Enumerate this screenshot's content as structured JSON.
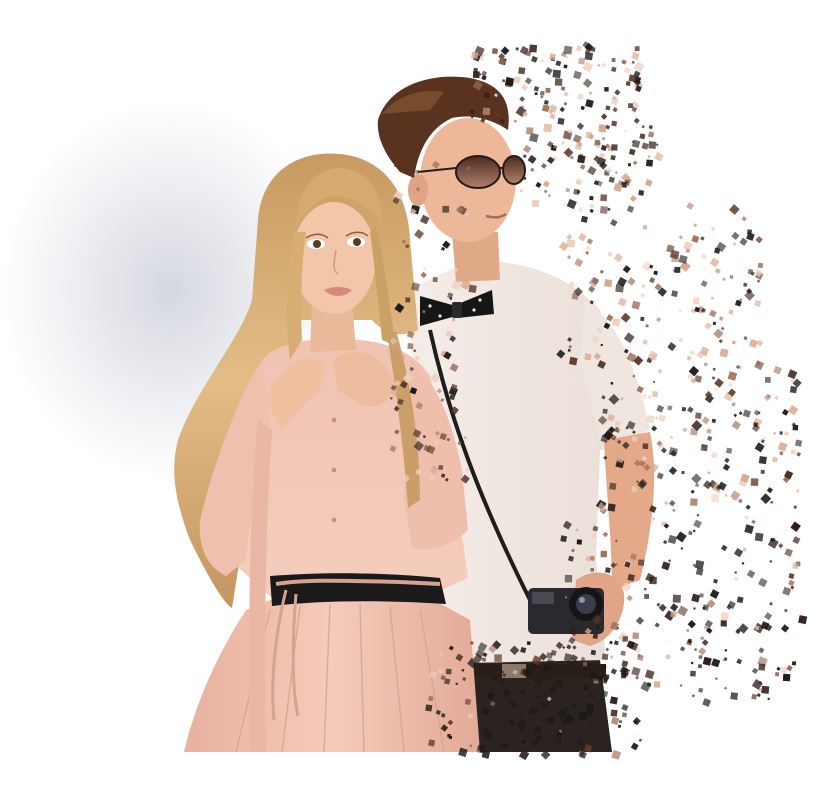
{
  "image": {
    "subject": "",
    "colors": {
      "background": "#ffffff",
      "haze": "#c8cbd6",
      "hair_blonde": "#d9b07a",
      "hair_blonde_shadow": "#a97b45",
      "skin_light": "#f2c7a8",
      "skin_shadow": "#d49a7a",
      "blouse_peach": "#f3c6b6",
      "blouse_shadow": "#dca08f",
      "belt_black": "#1a1a1a",
      "shirt_white": "#f3ece6",
      "bowtie_black": "#161616",
      "hair_brown": "#5a3320",
      "sunglass_lens": "#7a4a3a",
      "camera_black": "#2a2a2e",
      "particles": [
        "#2b1a14",
        "#5b3a2a",
        "#a0705a",
        "#d8a88e",
        "#efcfbd",
        "#1a1a1a"
      ]
    }
  }
}
